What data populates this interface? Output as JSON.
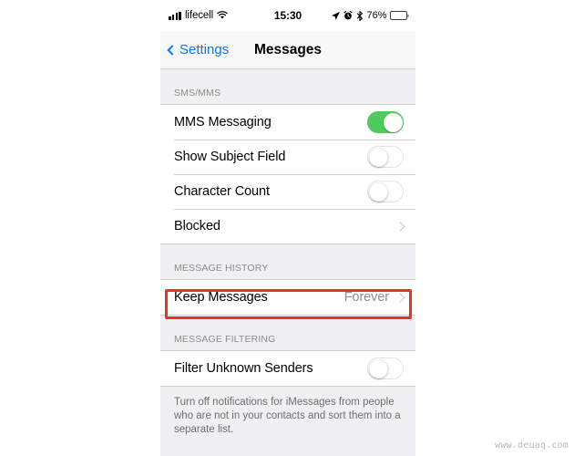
{
  "status_bar": {
    "carrier": "lifecell",
    "time": "15:30",
    "battery_percent": "76%",
    "icons": [
      "signal-bars-icon",
      "wifi-icon",
      "location-arrow-icon",
      "alarm-clock-icon",
      "bluetooth-icon",
      "battery-icon"
    ]
  },
  "nav_bar": {
    "back_label": "Settings",
    "title": "Messages"
  },
  "sections": [
    {
      "header": "SMS/MMS",
      "rows": [
        {
          "label": "MMS Messaging",
          "type": "toggle",
          "state": "on"
        },
        {
          "label": "Show Subject Field",
          "type": "toggle",
          "state": "off"
        },
        {
          "label": "Character Count",
          "type": "toggle",
          "state": "off"
        },
        {
          "label": "Blocked",
          "type": "disclosure",
          "value": ""
        }
      ]
    },
    {
      "header": "MESSAGE HISTORY",
      "rows": [
        {
          "label": "Keep Messages",
          "type": "disclosure",
          "value": "Forever",
          "highlighted": true
        }
      ]
    },
    {
      "header": "MESSAGE FILTERING",
      "rows": [
        {
          "label": "Filter Unknown Senders",
          "type": "toggle",
          "state": "off"
        }
      ],
      "footer": "Turn off notifications for iMessages from people who are not in your contacts and sort them into a separate list."
    }
  ],
  "colors": {
    "accent_blue": "#007aff",
    "toggle_on_green": "#4ecb5c",
    "annotation_red": "#ef3124",
    "section_bg": "#efeff4",
    "secondary_text": "#8e8e93"
  },
  "watermark": "www.deuaq.com"
}
